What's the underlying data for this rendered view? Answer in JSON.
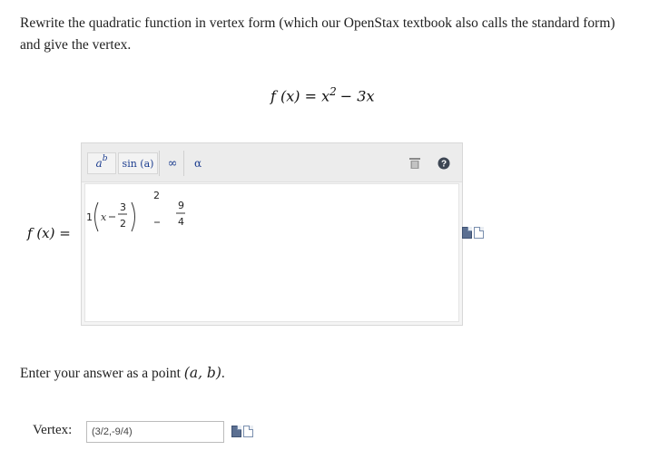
{
  "question": {
    "text": "Rewrite the quadratic function in vertex form (which our OpenStax textbook also calls the standard form) and give the vertex."
  },
  "given_function": {
    "lhs": "f (x) = x",
    "exponent": "2",
    "rhs": "− 3x"
  },
  "answer_label": "f (x) =",
  "toolbar": {
    "power_button": "a",
    "power_sup": "b",
    "sin_button": "sin (a)",
    "infinity_button": "∞",
    "alpha_button": "α",
    "delete_icon": "trash-icon",
    "help_icon": "help-icon"
  },
  "math_entry": {
    "leading": "1",
    "x": "x",
    "frac1_num": "3",
    "frac1_den": "2",
    "exponent": "2",
    "frac2_num": "9",
    "frac2_den": "4"
  },
  "instruction": {
    "prefix": "Enter your answer as a point",
    "point": "(a, b)",
    "suffix": "."
  },
  "vertex": {
    "label": "Vertex:",
    "value": "(3/2,-9/4)"
  },
  "colors": {
    "toolbar_text": "#1c3d8f",
    "editor_bg": "#f4f4f4",
    "toolbar_bg": "#ececec"
  }
}
